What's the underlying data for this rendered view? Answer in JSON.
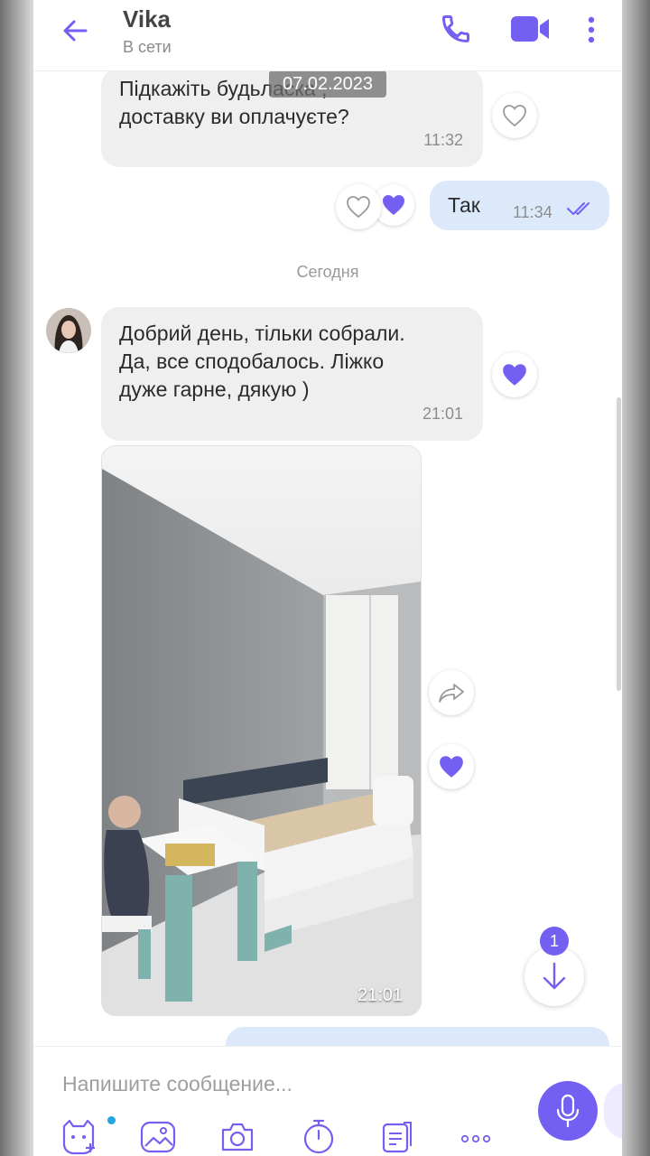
{
  "header": {
    "contact_name": "Vika",
    "status": "В сети"
  },
  "chat": {
    "date_pill": "07.02.2023",
    "messages": [
      {
        "text": "Підкажіть будьласка ,\nдоставку ви оплачуєте?",
        "time": "11:32",
        "direction": "incoming"
      },
      {
        "text": "Так",
        "time": "11:34",
        "direction": "outgoing",
        "read": true
      },
      {
        "text": "Добрий  день, тільки собрали.\nДа, все сподобалось. Ліжко\nдуже гарне, дякую )",
        "time": "21:01",
        "direction": "incoming"
      }
    ],
    "day_separator": "Сегодня",
    "photo": {
      "time": "21:01"
    },
    "unread_count": "1"
  },
  "composer": {
    "placeholder": "Напишите сообщение..."
  },
  "colors": {
    "accent": "#7360f2",
    "incoming_bubble": "#efefef",
    "outgoing_bubble": "#dbe9fb"
  },
  "icons": [
    "back-arrow-icon",
    "phone-icon",
    "video-icon",
    "more-icon",
    "heart-icon",
    "forward-icon",
    "arrow-down-icon",
    "sticker-icon",
    "gallery-icon",
    "camera-icon",
    "timer-icon",
    "gif-icon",
    "more-options-icon",
    "mic-icon"
  ]
}
